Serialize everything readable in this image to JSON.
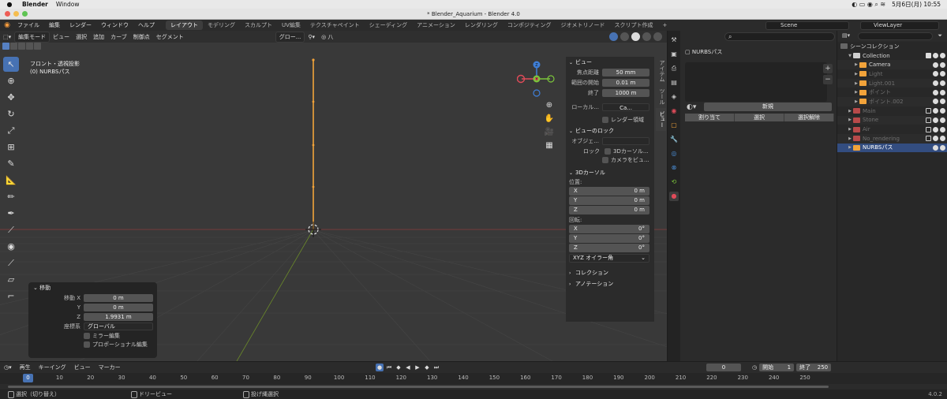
{
  "mac_menu": {
    "app": "Blender",
    "items": [
      "Window"
    ],
    "datetime": "5月6日(月)  10:55"
  },
  "window_title": "* Blender_Aquarium - Blender 4.0",
  "topbar": {
    "menus": [
      "ファイル",
      "編集",
      "レンダー",
      "ウィンドウ",
      "ヘルプ"
    ],
    "workspaces": [
      "レイアウト",
      "モデリング",
      "スカルプト",
      "UV編集",
      "テクスチャペイント",
      "シェーディング",
      "アニメーション",
      "レンダリング",
      "コンポジティング",
      "ジオメトリノード",
      "スクリプト作成"
    ],
    "active_workspace": "レイアウト",
    "scene": "Scene",
    "view_layer": "ViewLayer"
  },
  "viewport": {
    "header": {
      "mode": "編集モード",
      "menus": [
        "ビュー",
        "選択",
        "追加",
        "カーブ",
        "制御点",
        "セグメント"
      ],
      "orientation": "グロー..."
    },
    "info_line1": "フロント・透視投影",
    "info_line2": "(0) NURBSパス",
    "gizmo": {
      "z": "Z",
      "y": "Y",
      "x": "X"
    }
  },
  "npanel": {
    "tabs": [
      "アイテム",
      "ツール",
      "ビュー"
    ],
    "active_tab": "ビュー",
    "view_section": "ビュー",
    "focal_label": "焦点距離",
    "focal_value": "50 mm",
    "clip_start_label": "範囲の開始",
    "clip_start_value": "0.01 m",
    "clip_end_label": "終了",
    "clip_end_value": "1000 m",
    "local_label": "ローカル...",
    "local_camera": "Ca...",
    "render_region": "レンダー領域",
    "lock_section": "ビューのロック",
    "object_label": "オブジェ...",
    "lock_label": "ロック",
    "lock_3dcursor": "3Dカーソル...",
    "lock_camera": "カメラをビュ...",
    "cursor_section": "3Dカーソル",
    "location_label": "位置:",
    "loc": [
      {
        "axis": "X",
        "value": "0 m"
      },
      {
        "axis": "Y",
        "value": "0 m"
      },
      {
        "axis": "Z",
        "value": "0 m"
      }
    ],
    "rotation_label": "回転:",
    "rot": [
      {
        "axis": "X",
        "value": "0°"
      },
      {
        "axis": "Y",
        "value": "0°"
      },
      {
        "axis": "Z",
        "value": "0°"
      }
    ],
    "rot_mode": "XYZ オイラー角",
    "collection_section": "コレクション",
    "annotation_section": "アノテーション"
  },
  "operator": {
    "title": "移動",
    "move_label": "移動 X",
    "y_label": "Y",
    "z_label": "Z",
    "x_value": "0 m",
    "y_value": "0 m",
    "z_value": "1.9931 m",
    "orient_label": "座標系",
    "orient_value": "グローバル",
    "mirror": "ミラー編集",
    "proportional": "プロポーショナル編集"
  },
  "properties": {
    "object_name": "NURBSパス",
    "new_button": "新規",
    "assign": "割り当て",
    "select": "選択",
    "deselect": "選択解除"
  },
  "outliner": {
    "scene_collection": "シーンコレクション",
    "rows": [
      {
        "name": "Collection",
        "indent": 1,
        "kind": "collection",
        "dim": false
      },
      {
        "name": "Camera",
        "indent": 2,
        "kind": "camera",
        "dim": false
      },
      {
        "name": "Light",
        "indent": 2,
        "kind": "light",
        "dim": true
      },
      {
        "name": "Light.001",
        "indent": 2,
        "kind": "light",
        "dim": true
      },
      {
        "name": "ポイント",
        "indent": 2,
        "kind": "light",
        "dim": true
      },
      {
        "name": "ポイント.002",
        "indent": 2,
        "kind": "light",
        "dim": true
      },
      {
        "name": "Main",
        "indent": 1,
        "kind": "collection-red",
        "dim": true
      },
      {
        "name": "Stone",
        "indent": 1,
        "kind": "collection-red",
        "dim": true
      },
      {
        "name": "Air",
        "indent": 1,
        "kind": "collection-red",
        "dim": true
      },
      {
        "name": "No_rendering",
        "indent": 1,
        "kind": "collection-red",
        "dim": true
      },
      {
        "name": "NURBSパス",
        "indent": 1,
        "kind": "curve",
        "dim": false,
        "selected": true
      }
    ]
  },
  "timeline": {
    "menus": [
      "再生",
      "キーイング",
      "ビュー",
      "マーカー"
    ],
    "current_frame": "0",
    "start_label": "開始",
    "start_value": "1",
    "end_label": "終了",
    "end_value": "250",
    "ticks": [
      "0",
      "10",
      "20",
      "30",
      "40",
      "50",
      "60",
      "70",
      "80",
      "90",
      "100",
      "110",
      "120",
      "130",
      "140",
      "150",
      "160",
      "170",
      "180",
      "190",
      "200",
      "210",
      "220",
      "230",
      "240",
      "250"
    ]
  },
  "statusbar": {
    "items": [
      "選択（切り替え）",
      "ドリービュー",
      "投げ縄選択"
    ],
    "version": "4.0.2"
  },
  "colors": {
    "accent": "#4772b3",
    "curve": "#f2a33a",
    "gizmo_x": "#e04b59",
    "gizmo_y": "#7bc43b",
    "gizmo_z": "#3f7fd8"
  }
}
